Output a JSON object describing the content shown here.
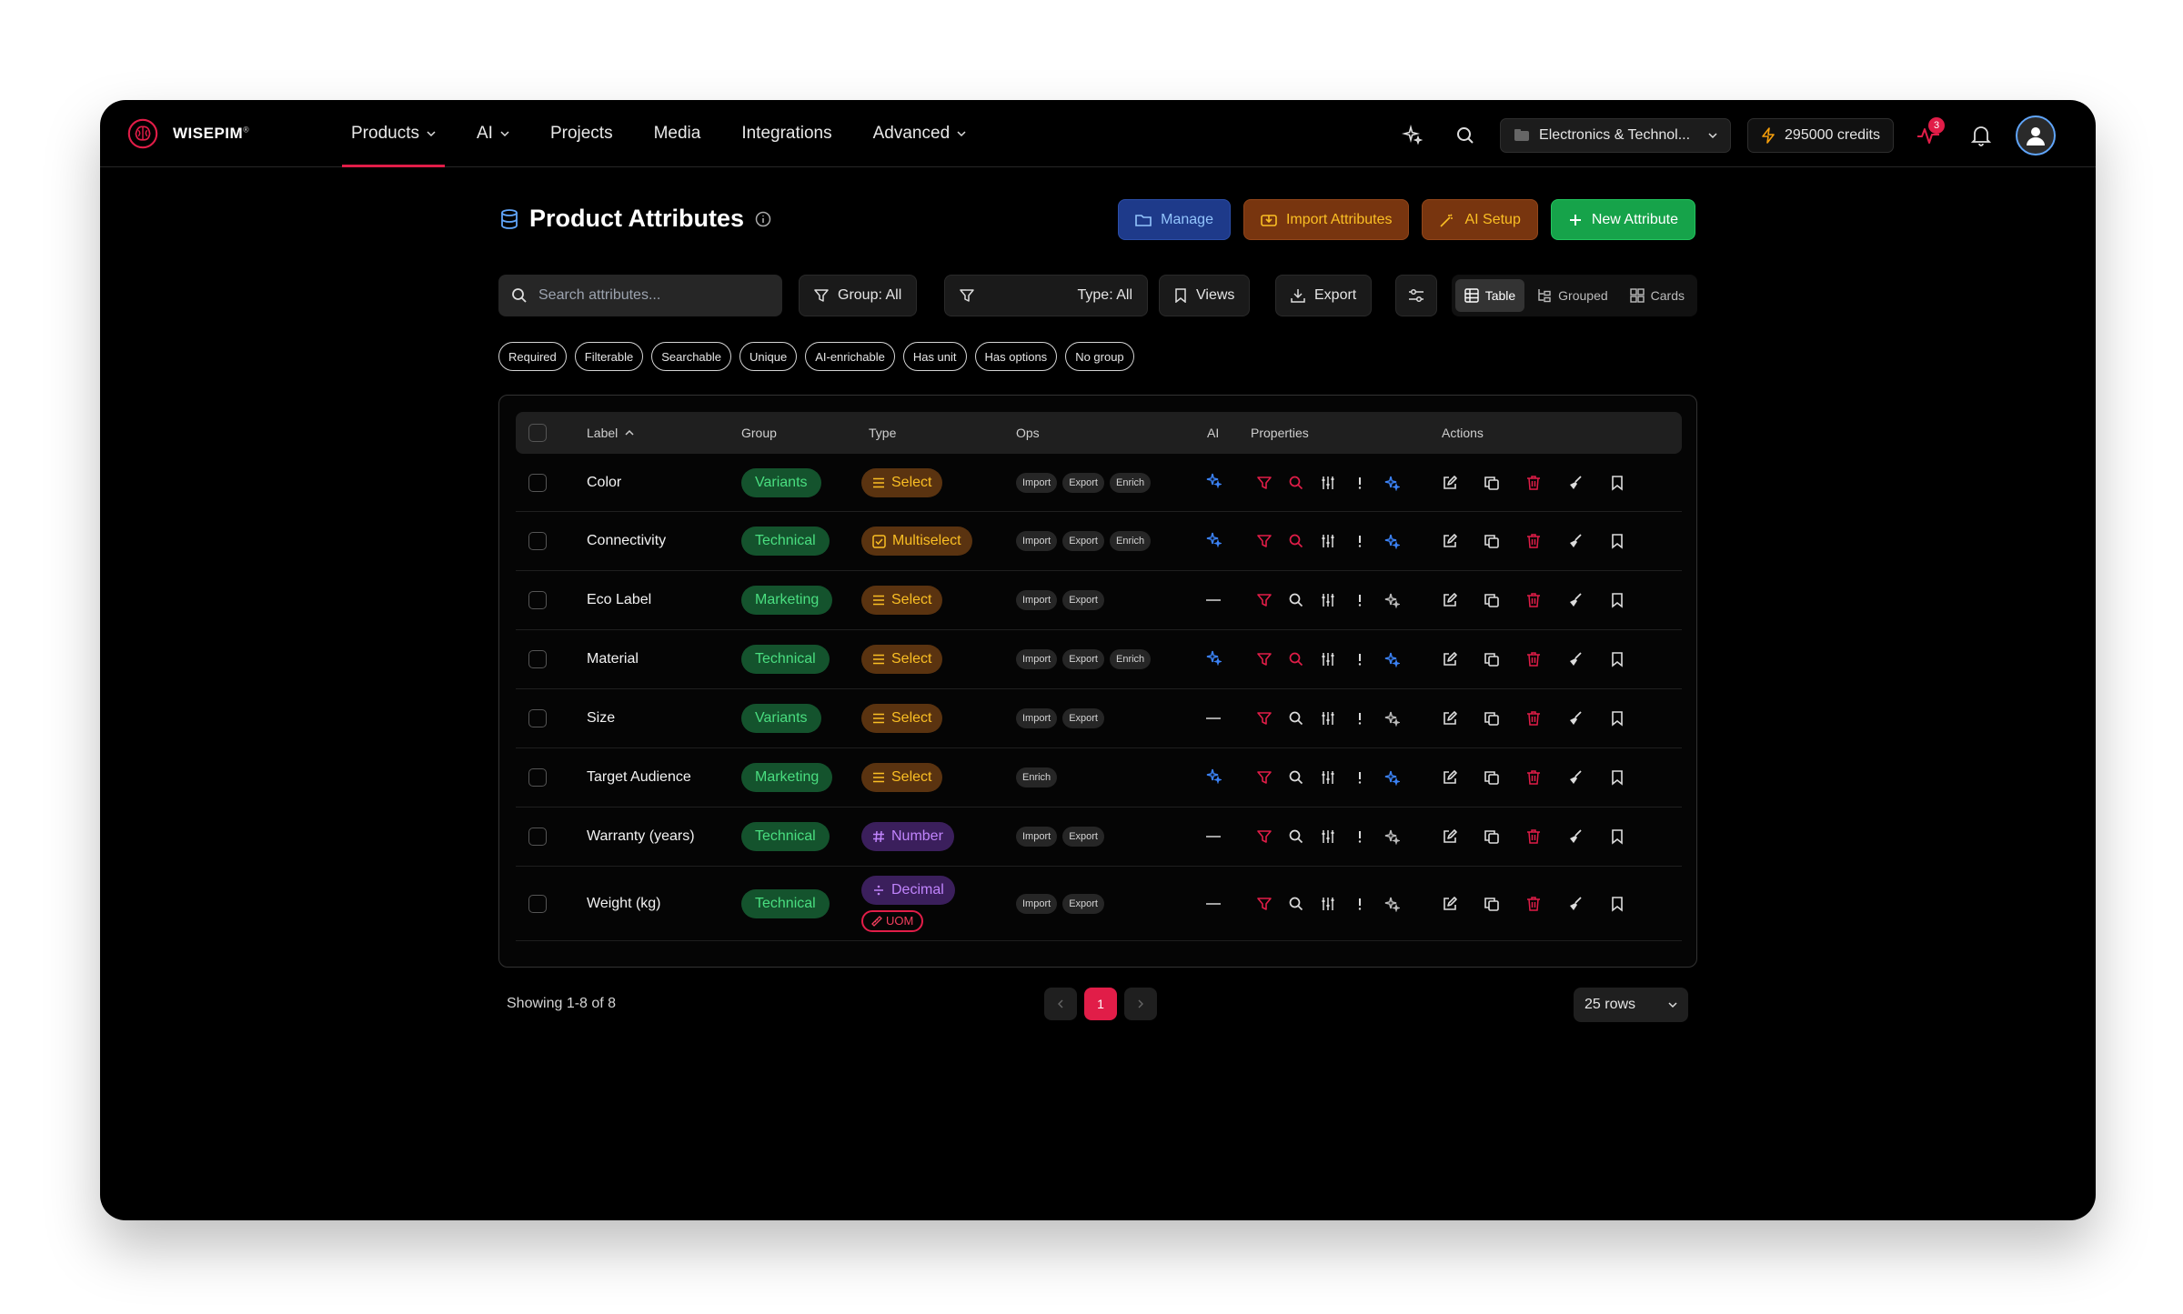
{
  "app": {
    "name": "WISEPIM",
    "trademark": "®"
  },
  "nav": {
    "items": [
      {
        "label": "Products",
        "has_menu": true,
        "active": true
      },
      {
        "label": "AI",
        "has_menu": true
      },
      {
        "label": "Projects"
      },
      {
        "label": "Media"
      },
      {
        "label": "Integrations"
      },
      {
        "label": "Advanced",
        "has_menu": true
      }
    ],
    "workspace": "Electronics & Technol...",
    "credits": "295000 credits",
    "activity_count": "3"
  },
  "page": {
    "title": "Product Attributes",
    "buttons": {
      "manage": "Manage",
      "import": "Import Attributes",
      "ai_setup": "AI Setup",
      "new": "New Attribute"
    }
  },
  "toolbar": {
    "search_placeholder": "Search attributes...",
    "group_filter": "Group: All",
    "type_filter": "Type: All",
    "views": "Views",
    "export": "Export",
    "view_modes": [
      "Table",
      "Grouped",
      "Cards"
    ]
  },
  "chips": [
    "Required",
    "Filterable",
    "Searchable",
    "Unique",
    "AI-enrichable",
    "Has unit",
    "Has options",
    "No group"
  ],
  "table": {
    "headers": {
      "label": "Label",
      "group": "Group",
      "type": "Type",
      "ops": "Ops",
      "ai": "AI",
      "properties": "Properties",
      "actions": "Actions"
    },
    "rows": [
      {
        "label": "Color",
        "group": "Variants",
        "type": "Select",
        "type_kind": "select",
        "ops": [
          "Import",
          "Export",
          "Enrich"
        ],
        "ai": true,
        "search_active": true
      },
      {
        "label": "Connectivity",
        "group": "Technical",
        "type": "Multiselect",
        "type_kind": "multi",
        "ops": [
          "Import",
          "Export",
          "Enrich"
        ],
        "ai": true,
        "search_active": true
      },
      {
        "label": "Eco Label",
        "group": "Marketing",
        "type": "Select",
        "type_kind": "select",
        "ops": [
          "Import",
          "Export"
        ],
        "ai": false,
        "search_active": false
      },
      {
        "label": "Material",
        "group": "Technical",
        "type": "Select",
        "type_kind": "select",
        "ops": [
          "Import",
          "Export",
          "Enrich"
        ],
        "ai": true,
        "search_active": true
      },
      {
        "label": "Size",
        "group": "Variants",
        "type": "Select",
        "type_kind": "select",
        "ops": [
          "Import",
          "Export"
        ],
        "ai": false,
        "search_active": false
      },
      {
        "label": "Target Audience",
        "group": "Marketing",
        "type": "Select",
        "type_kind": "select",
        "ops": [
          "Enrich"
        ],
        "ai": true,
        "search_active": false
      },
      {
        "label": "Warranty (years)",
        "group": "Technical",
        "type": "Number",
        "type_kind": "number",
        "ops": [
          "Import",
          "Export"
        ],
        "ai": false,
        "search_active": false
      },
      {
        "label": "Weight (kg)",
        "group": "Technical",
        "type": "Decimal",
        "type_kind": "decimal",
        "uom": "UOM",
        "ops": [
          "Import",
          "Export"
        ],
        "ai": false,
        "search_active": false
      }
    ]
  },
  "footer": {
    "showing": "Showing 1-8 of 8",
    "current_page": "1",
    "rows_per_page": "25 rows"
  },
  "colors": {
    "accent": "#e11d48",
    "ai_blue": "#3b82f6",
    "group_green": "#4ade80",
    "type_amber": "#fbbf24",
    "type_purple": "#c084fc"
  }
}
